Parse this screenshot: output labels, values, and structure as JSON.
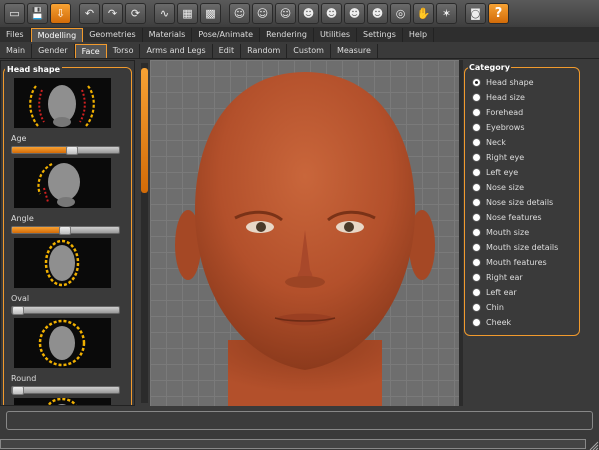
{
  "toolbar": {
    "icons": [
      "window-icon",
      "save-icon",
      "export-icon",
      "undo-icon",
      "redo-icon",
      "reset-icon",
      "smooth-icon",
      "wireframe-icon",
      "background-icon",
      "front-view-icon",
      "left-view-icon",
      "top-view-icon",
      "head-front-icon",
      "head-back-icon",
      "head-left-icon",
      "head-right-icon",
      "face-mask-icon",
      "pose-hands-icon",
      "skeleton-icon",
      "screenshot-icon",
      "help-icon"
    ],
    "help_glyph": "?"
  },
  "main_tabs": [
    {
      "label": "Files",
      "active": false
    },
    {
      "label": "Modelling",
      "active": true
    },
    {
      "label": "Geometries",
      "active": false
    },
    {
      "label": "Materials",
      "active": false
    },
    {
      "label": "Pose/Animate",
      "active": false
    },
    {
      "label": "Rendering",
      "active": false
    },
    {
      "label": "Utilities",
      "active": false
    },
    {
      "label": "Settings",
      "active": false
    },
    {
      "label": "Help",
      "active": false
    }
  ],
  "sub_tabs": [
    {
      "label": "Main",
      "active": false
    },
    {
      "label": "Gender",
      "active": false
    },
    {
      "label": "Face",
      "active": true
    },
    {
      "label": "Torso",
      "active": false
    },
    {
      "label": "Arms and Legs",
      "active": false
    },
    {
      "label": "Edit",
      "active": false
    },
    {
      "label": "Random",
      "active": false
    },
    {
      "label": "Custom",
      "active": false
    },
    {
      "label": "Measure",
      "active": false
    }
  ],
  "left_panel": {
    "title": "Head shape",
    "items": [
      {
        "label": "Age",
        "value": 0.56
      },
      {
        "label": "Angle",
        "value": 0.5
      },
      {
        "label": "Oval",
        "value": 0.0
      },
      {
        "label": "Round",
        "value": 0.0
      }
    ]
  },
  "category": {
    "title": "Category",
    "options": [
      "Head shape",
      "Head size",
      "Forehead",
      "Eyebrows",
      "Neck",
      "Right eye",
      "Left eye",
      "Nose size",
      "Nose size details",
      "Nose features",
      "Mouth size",
      "Mouth size details",
      "Mouth features",
      "Right ear",
      "Left ear",
      "Chin",
      "Cheek"
    ],
    "selected": "Head shape"
  },
  "colors": {
    "accent": "#f19a2d",
    "skin": "#b8552f",
    "viewport_bg": "#6e6e6e"
  }
}
